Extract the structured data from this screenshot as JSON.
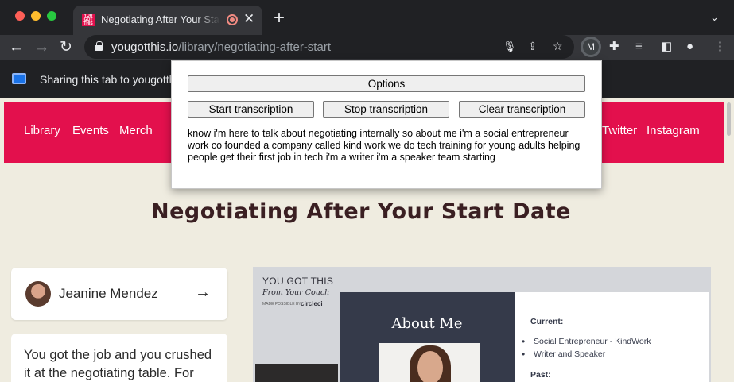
{
  "browser": {
    "tab_title": "Negotiating After Your Start Date",
    "favicon_text": "YOU GOT THIS",
    "url_host": "yougotthis.io",
    "url_path": "/library/negotiating-after-start",
    "extension_letter": "M",
    "share_text": "Sharing this tab to yougotthis.io"
  },
  "site_nav": {
    "left_links": [
      "Library",
      "Events",
      "Merch"
    ],
    "right_links": [
      "Twitter",
      "Instagram"
    ]
  },
  "page": {
    "title": "Negotiating After Your Start Date",
    "author_name": "Jeanine Mendez",
    "description": "You got the job and you crushed it at the negotiating table. For"
  },
  "slide": {
    "brand_line1": "YOU GOT THIS",
    "brand_line2": "From Your Couch",
    "brand_line3": "MADE POSSIBLE BY",
    "brand_line4": "circleci",
    "heading": "About Me",
    "current_label": "Current:",
    "current_items": [
      "Social Entrepreneur - KindWork",
      "Writer and Speaker"
    ],
    "past_label": "Past:"
  },
  "popup": {
    "options_label": "Options",
    "start_label": "Start transcription",
    "stop_label": "Stop transcription",
    "clear_label": "Clear transcription",
    "transcript": "know i'm here to talk about negotiating internally so about me i'm a social entrepreneur work co founded a company called kind work we do tech training for young adults helping people get their first job in tech i'm a writer i'm a speaker team starting"
  }
}
